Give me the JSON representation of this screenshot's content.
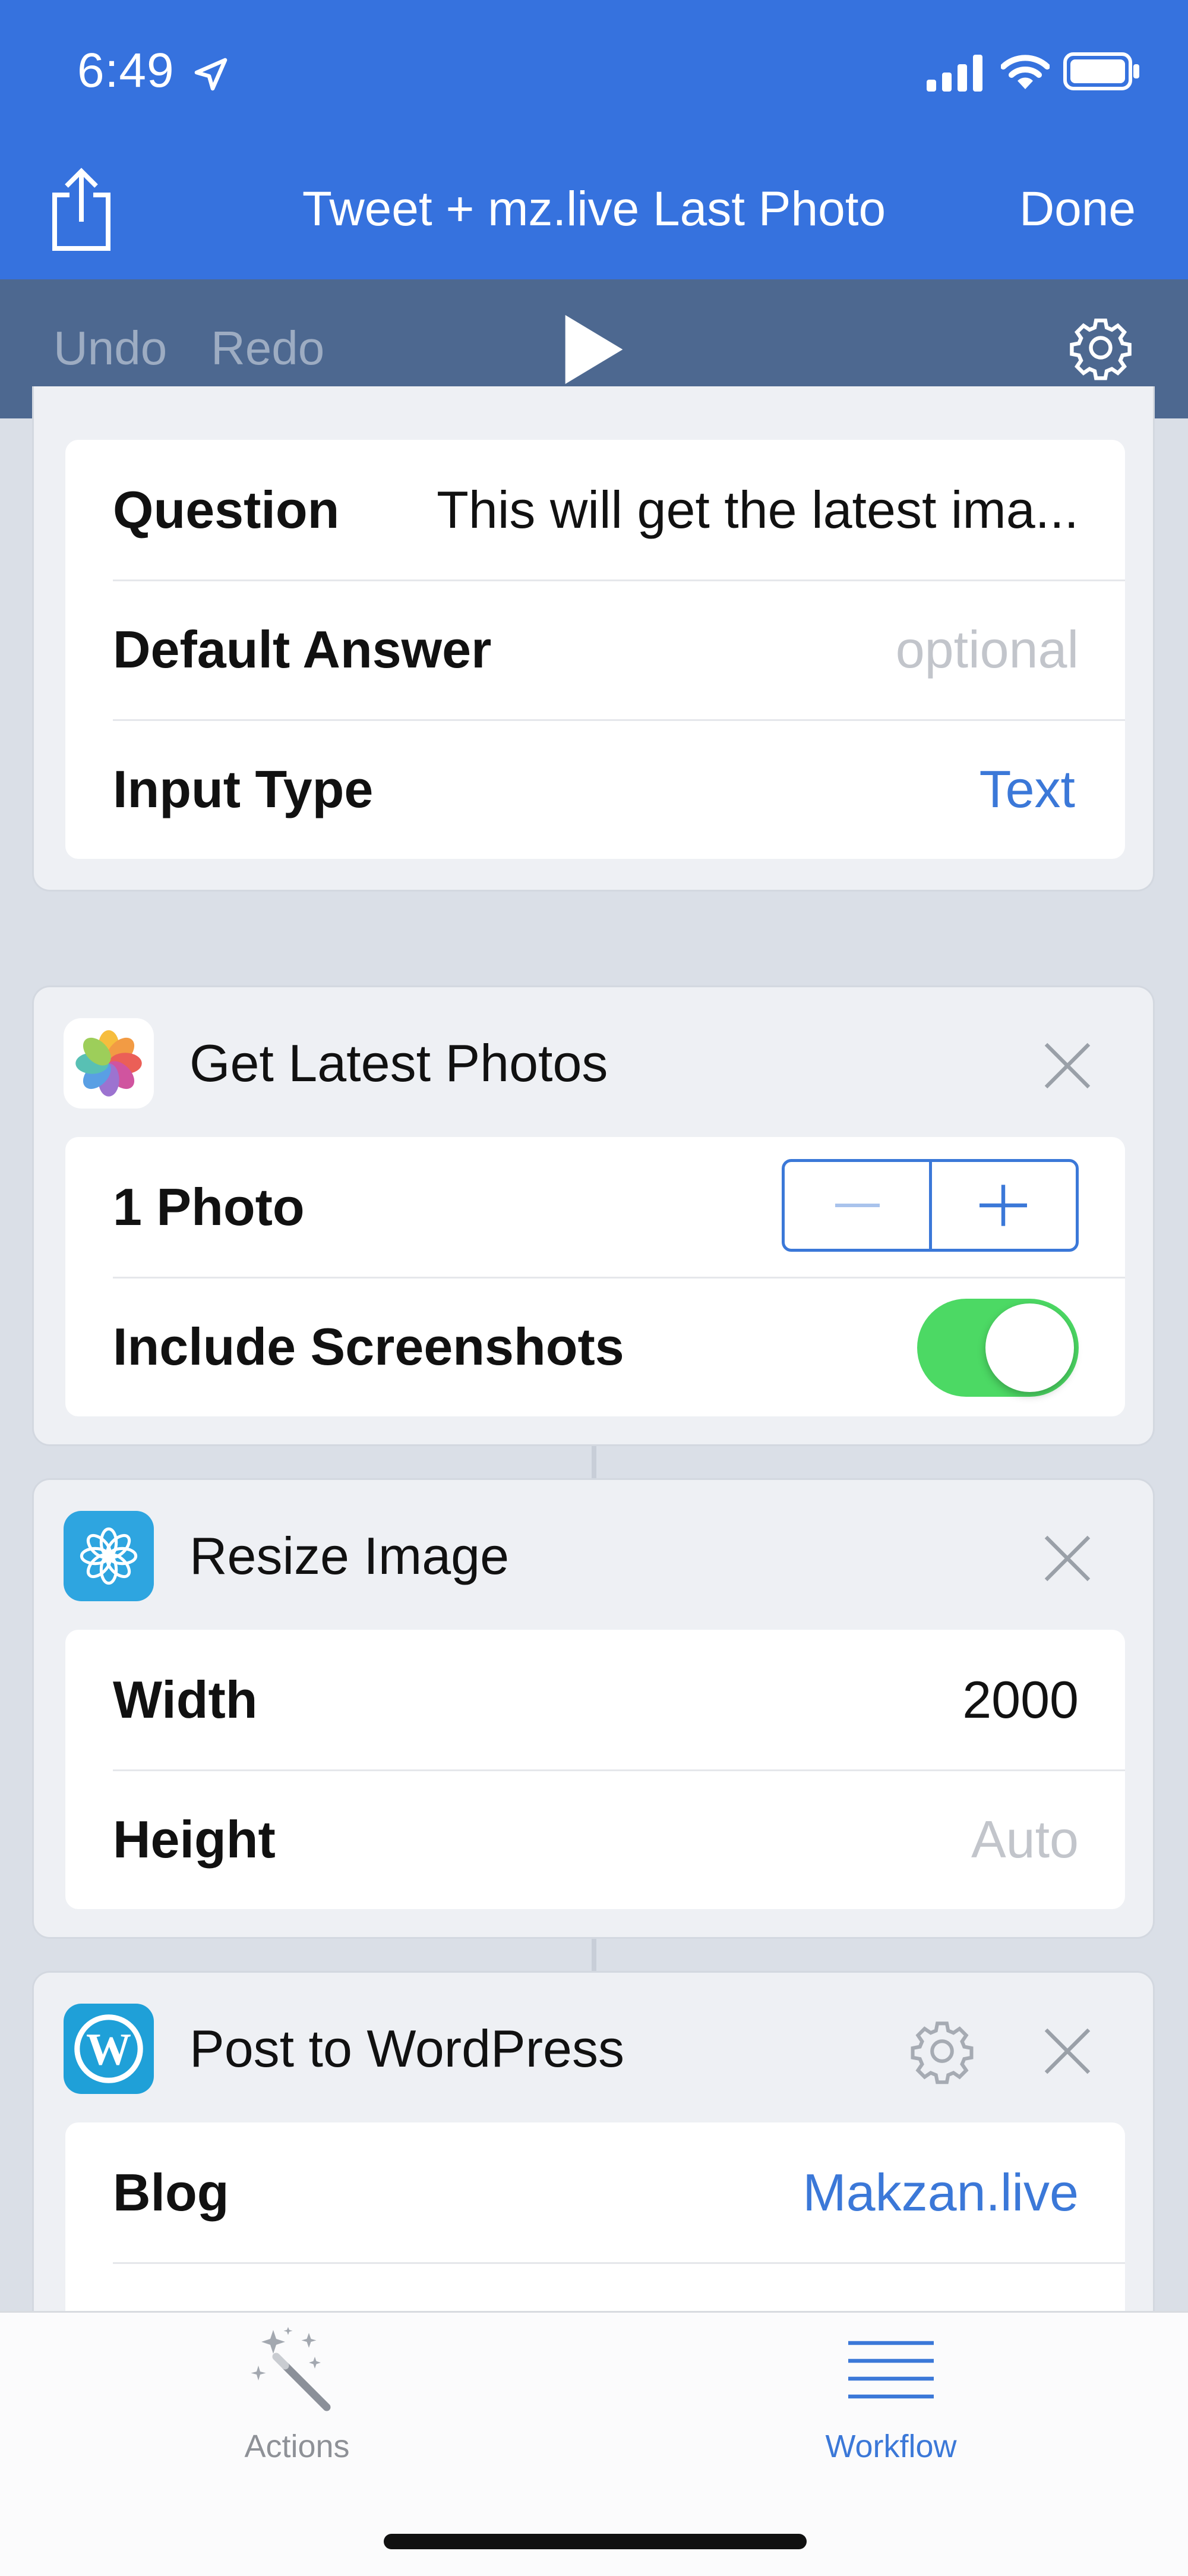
{
  "status_bar": {
    "time": "6:49"
  },
  "nav": {
    "title": "Tweet + mz.live Last Photo",
    "done_label": "Done"
  },
  "toolbar": {
    "undo_label": "Undo",
    "redo_label": "Redo"
  },
  "ask_card": {
    "rows": [
      {
        "label": "Question",
        "value": "This will get the latest ima..."
      },
      {
        "label": "Default Answer",
        "placeholder": "optional"
      },
      {
        "label": "Input Type",
        "value": "Text"
      }
    ]
  },
  "photos_card": {
    "title": "Get Latest Photos",
    "count_label": "1 Photo",
    "screenshots_label": "Include Screenshots",
    "include_screenshots": true
  },
  "resize_card": {
    "title": "Resize Image",
    "width_label": "Width",
    "width_value": "2000",
    "height_label": "Height",
    "height_placeholder": "Auto"
  },
  "wordpress_card": {
    "title": "Post to WordPress",
    "blog_label": "Blog",
    "blog_value": "Makzan.live"
  },
  "tabbar": {
    "tabs": [
      {
        "label": "Actions",
        "active": false,
        "icon": "magic-wand-icon"
      },
      {
        "label": "Workflow",
        "active": true,
        "icon": "list-icon"
      }
    ]
  },
  "colors": {
    "accent": "#3b78d8",
    "nav_bg": "#3672de",
    "toolbar_bg": "#4d6890",
    "toggle_on": "#4cd964"
  }
}
